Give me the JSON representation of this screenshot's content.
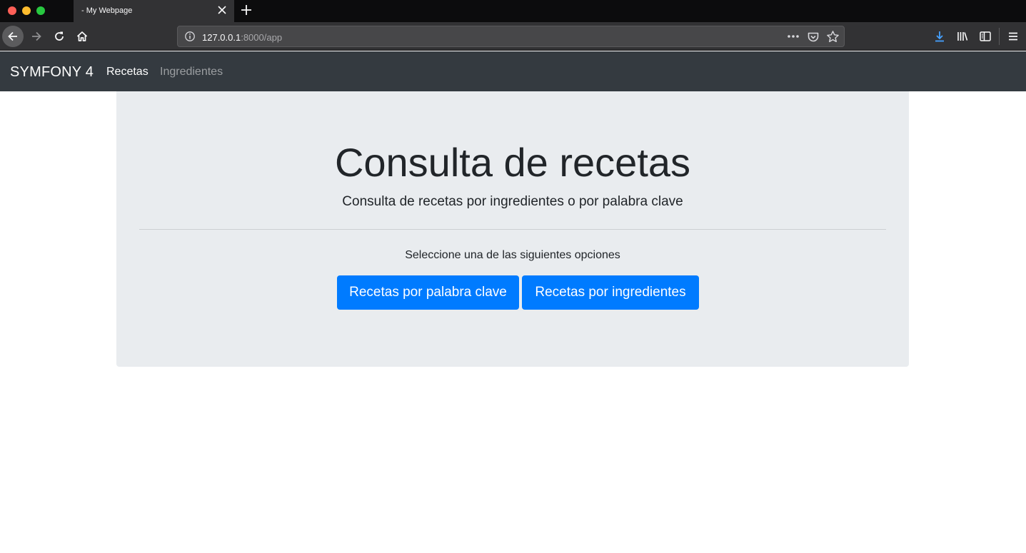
{
  "browser": {
    "tab_title": "- My Webpage",
    "url_host": "127.0.0.1",
    "url_rest": ":8000/app",
    "icons": [
      "back-icon",
      "forward-icon",
      "reload-icon",
      "home-icon",
      "info-icon",
      "more-icon",
      "pocket-icon",
      "star-icon",
      "download-icon",
      "library-icon",
      "sidebar-icon",
      "menu-icon"
    ]
  },
  "navbar": {
    "brand": "SYMFONY 4",
    "links": [
      {
        "label": "Recetas",
        "active": true
      },
      {
        "label": "Ingredientes",
        "active": false
      }
    ]
  },
  "jumbotron": {
    "title": "Consulta de recetas",
    "lead": "Consulta de recetas por ingredientes o por palabra clave",
    "instruction": "Seleccione una de las siguientes opciones",
    "buttons": [
      {
        "label": "Recetas por palabra clave"
      },
      {
        "label": "Recetas por ingredientes"
      }
    ]
  },
  "colors": {
    "primary": "#007bff",
    "navbar": "#343a40",
    "jumbotron": "#e9ecef",
    "download_accent": "#45a1ff"
  }
}
